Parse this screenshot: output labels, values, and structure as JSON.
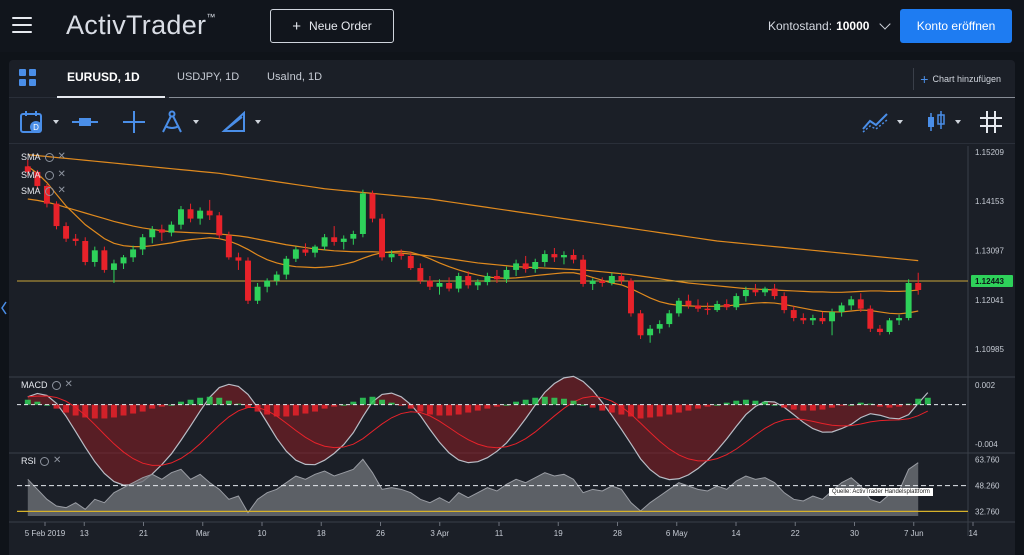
{
  "header": {
    "logo": "ActivTrader",
    "logo_tm": "™",
    "new_order_label": "Neue Order",
    "balance_label": "Kontostand:",
    "balance_value": "10000",
    "open_account_label": "Konto eröffnen"
  },
  "tabs": [
    {
      "label": "EURUSD, 1D",
      "active": true
    },
    {
      "label": "USDJPY, 1D",
      "active": false
    },
    {
      "label": "UsaInd, 1D",
      "active": false
    }
  ],
  "add_chart_label": "Chart hinzufügen",
  "indicators": {
    "sma": [
      "SMA",
      "SMA",
      "SMA"
    ],
    "macd": "MACD",
    "rsi": "RSI"
  },
  "watermark": "Quelle: ActivTrader Handelsplattform",
  "colors": {
    "up": "#2ed15a",
    "down": "#e8222a",
    "sma": "#e08a1e",
    "accent": "#1e7cf2",
    "price_line": "#c9a43a"
  },
  "chart_data": {
    "type": "candlestick",
    "symbol": "EURUSD",
    "timeframe": "1D",
    "price_axis_ticks": [
      "1.15209",
      "1.14153",
      "1.13097",
      "1.12041",
      "1.10985"
    ],
    "price_ylim": [
      1.1045,
      1.1525
    ],
    "current_price": "1.12443",
    "current_price_value": 1.12443,
    "x_tick_labels": [
      "5 Feb 2019",
      "13",
      "21",
      "Mar",
      "10",
      "18",
      "26",
      "3 Apr",
      "11",
      "19",
      "28",
      "6 May",
      "14",
      "22",
      "30",
      "7 Jun",
      "14"
    ],
    "candles": [
      [
        1.149,
        1.1505,
        1.147,
        1.1478
      ],
      [
        1.1478,
        1.1482,
        1.144,
        1.1448
      ],
      [
        1.1448,
        1.1452,
        1.1402,
        1.141
      ],
      [
        1.141,
        1.1415,
        1.1355,
        1.1362
      ],
      [
        1.1362,
        1.137,
        1.1328,
        1.1335
      ],
      [
        1.1335,
        1.1345,
        1.132,
        1.133
      ],
      [
        1.133,
        1.1338,
        1.1278,
        1.1285
      ],
      [
        1.1285,
        1.1318,
        1.1275,
        1.131
      ],
      [
        1.131,
        1.1318,
        1.1262,
        1.1268
      ],
      [
        1.1268,
        1.129,
        1.124,
        1.1282
      ],
      [
        1.1282,
        1.13,
        1.127,
        1.1295
      ],
      [
        1.1295,
        1.132,
        1.1285,
        1.1312
      ],
      [
        1.1312,
        1.1345,
        1.13,
        1.1338
      ],
      [
        1.1338,
        1.1362,
        1.1325,
        1.1355
      ],
      [
        1.1355,
        1.1365,
        1.133,
        1.1348
      ],
      [
        1.1348,
        1.1372,
        1.134,
        1.1365
      ],
      [
        1.1365,
        1.1405,
        1.1355,
        1.1398
      ],
      [
        1.1398,
        1.141,
        1.137,
        1.1378
      ],
      [
        1.1378,
        1.1402,
        1.1365,
        1.1395
      ],
      [
        1.1395,
        1.1418,
        1.1375,
        1.1385
      ],
      [
        1.1385,
        1.1392,
        1.1335,
        1.1342
      ],
      [
        1.1342,
        1.135,
        1.129,
        1.1295
      ],
      [
        1.1295,
        1.1305,
        1.1268,
        1.1288
      ],
      [
        1.1288,
        1.1295,
        1.1195,
        1.1202
      ],
      [
        1.1202,
        1.124,
        1.1195,
        1.1232
      ],
      [
        1.1232,
        1.125,
        1.122,
        1.1245
      ],
      [
        1.1245,
        1.1265,
        1.1235,
        1.1258
      ],
      [
        1.1258,
        1.1298,
        1.1248,
        1.1292
      ],
      [
        1.1292,
        1.1318,
        1.1285,
        1.1312
      ],
      [
        1.1312,
        1.1325,
        1.1298,
        1.1305
      ],
      [
        1.1305,
        1.1322,
        1.1295,
        1.1318
      ],
      [
        1.1318,
        1.1345,
        1.131,
        1.1338
      ],
      [
        1.1338,
        1.1362,
        1.132,
        1.1328
      ],
      [
        1.1328,
        1.1342,
        1.1312,
        1.1335
      ],
      [
        1.1335,
        1.1352,
        1.1322,
        1.1345
      ],
      [
        1.1345,
        1.144,
        1.1338,
        1.1432
      ],
      [
        1.1432,
        1.1438,
        1.137,
        1.1378
      ],
      [
        1.1378,
        1.1388,
        1.1288,
        1.1295
      ],
      [
        1.1295,
        1.131,
        1.1285,
        1.1302
      ],
      [
        1.1302,
        1.1312,
        1.129,
        1.1298
      ],
      [
        1.1298,
        1.1305,
        1.1268,
        1.1272
      ],
      [
        1.1272,
        1.1282,
        1.1238,
        1.1245
      ],
      [
        1.1245,
        1.1255,
        1.1225,
        1.1232
      ],
      [
        1.1232,
        1.1248,
        1.1215,
        1.124
      ],
      [
        1.124,
        1.1252,
        1.1222,
        1.1228
      ],
      [
        1.1228,
        1.1262,
        1.122,
        1.1255
      ],
      [
        1.1255,
        1.1265,
        1.1228,
        1.1235
      ],
      [
        1.1235,
        1.1248,
        1.1225,
        1.1242
      ],
      [
        1.1242,
        1.1262,
        1.1235,
        1.1255
      ],
      [
        1.1255,
        1.1268,
        1.124,
        1.1248
      ],
      [
        1.1248,
        1.1275,
        1.124,
        1.1268
      ],
      [
        1.1268,
        1.129,
        1.1255,
        1.1282
      ],
      [
        1.1282,
        1.1298,
        1.1262,
        1.127
      ],
      [
        1.127,
        1.1292,
        1.1262,
        1.1285
      ],
      [
        1.1285,
        1.131,
        1.1275,
        1.1302
      ],
      [
        1.1302,
        1.1315,
        1.1285,
        1.1295
      ],
      [
        1.1295,
        1.1308,
        1.128,
        1.13
      ],
      [
        1.13,
        1.1312,
        1.1282,
        1.129
      ],
      [
        1.129,
        1.13,
        1.1232,
        1.1238
      ],
      [
        1.1238,
        1.125,
        1.1225,
        1.1245
      ],
      [
        1.1245,
        1.1252,
        1.1232,
        1.124
      ],
      [
        1.124,
        1.1262,
        1.1235,
        1.1255
      ],
      [
        1.1255,
        1.1262,
        1.1238,
        1.1245
      ],
      [
        1.1245,
        1.125,
        1.1168,
        1.1175
      ],
      [
        1.1175,
        1.1182,
        1.112,
        1.1128
      ],
      [
        1.1128,
        1.115,
        1.1112,
        1.1142
      ],
      [
        1.1142,
        1.116,
        1.1132,
        1.1152
      ],
      [
        1.1152,
        1.1182,
        1.1145,
        1.1175
      ],
      [
        1.1175,
        1.1208,
        1.1168,
        1.1202
      ],
      [
        1.1202,
        1.1215,
        1.1185,
        1.1192
      ],
      [
        1.1192,
        1.1205,
        1.1178,
        1.1185
      ],
      [
        1.1185,
        1.1198,
        1.1172,
        1.1182
      ],
      [
        1.1182,
        1.1202,
        1.1178,
        1.1195
      ],
      [
        1.1195,
        1.1205,
        1.1182,
        1.1188
      ],
      [
        1.1188,
        1.1218,
        1.1182,
        1.1212
      ],
      [
        1.1212,
        1.1232,
        1.12,
        1.1225
      ],
      [
        1.1225,
        1.1238,
        1.1212,
        1.122
      ],
      [
        1.122,
        1.1232,
        1.1212,
        1.1228
      ],
      [
        1.1228,
        1.1238,
        1.1205,
        1.1212
      ],
      [
        1.1212,
        1.122,
        1.1175,
        1.1182
      ],
      [
        1.1182,
        1.119,
        1.1158,
        1.1165
      ],
      [
        1.1165,
        1.1175,
        1.1152,
        1.116
      ],
      [
        1.116,
        1.1172,
        1.115,
        1.1165
      ],
      [
        1.1165,
        1.1178,
        1.1152,
        1.1158
      ],
      [
        1.1158,
        1.1185,
        1.1128,
        1.1178
      ],
      [
        1.1178,
        1.1198,
        1.1168,
        1.1192
      ],
      [
        1.1192,
        1.1212,
        1.1182,
        1.1205
      ],
      [
        1.1205,
        1.1218,
        1.1178,
        1.1185
      ],
      [
        1.1185,
        1.1192,
        1.1135,
        1.1142
      ],
      [
        1.1142,
        1.115,
        1.1128,
        1.1135
      ],
      [
        1.1135,
        1.1165,
        1.113,
        1.116
      ],
      [
        1.116,
        1.1172,
        1.115,
        1.1165
      ],
      [
        1.1165,
        1.1248,
        1.116,
        1.124
      ],
      [
        1.124,
        1.1262,
        1.1215,
        1.1225
      ]
    ],
    "sma_series": [
      {
        "name": "SMA",
        "values": [
          1.149,
          1.1475,
          1.1455,
          1.143,
          1.1405,
          1.1385,
          1.1365,
          1.135,
          1.1335,
          1.1325,
          1.132,
          1.1318,
          1.1318,
          1.132,
          1.1323,
          1.1326,
          1.133,
          1.1333,
          1.1335,
          1.1337,
          1.1335,
          1.133,
          1.1322,
          1.1312,
          1.13,
          1.129,
          1.1283,
          1.1278,
          1.1275,
          1.1274,
          1.1273,
          1.1274,
          1.1276,
          1.128,
          1.1285,
          1.1293,
          1.13,
          1.1305,
          1.1307,
          1.1308,
          1.1306,
          1.13,
          1.1292,
          1.1283,
          1.1275,
          1.1268,
          1.1262,
          1.1257,
          1.1253,
          1.1251,
          1.125,
          1.1251,
          1.1253,
          1.1256,
          1.1258,
          1.126,
          1.1262,
          1.1262,
          1.1258,
          1.1252,
          1.1246,
          1.124,
          1.1236,
          1.1228,
          1.1218,
          1.1208,
          1.12,
          1.1195,
          1.1192,
          1.1191,
          1.119,
          1.119,
          1.119,
          1.1191,
          1.1193,
          1.1195,
          1.1197,
          1.1198,
          1.1197,
          1.1194,
          1.119,
          1.1186,
          1.1182,
          1.1179,
          1.1178,
          1.1178,
          1.118,
          1.1182,
          1.1181,
          1.1178,
          1.1175,
          1.1174,
          1.1176,
          1.118
        ]
      },
      {
        "name": "SMA",
        "values": [
          1.142,
          1.1417,
          1.1413,
          1.1408,
          1.1402,
          1.1396,
          1.139,
          1.1384,
          1.1378,
          1.1372,
          1.1367,
          1.1362,
          1.1358,
          1.1355,
          1.1352,
          1.135,
          1.1349,
          1.1348,
          1.1347,
          1.1346,
          1.1345,
          1.1343,
          1.1341,
          1.1338,
          1.1334,
          1.133,
          1.1326,
          1.1322,
          1.1319,
          1.1316,
          1.1313,
          1.1311,
          1.1309,
          1.1308,
          1.1307,
          1.1307,
          1.1307,
          1.1306,
          1.1305,
          1.1304,
          1.1302,
          1.13,
          1.1298,
          1.1295,
          1.1292,
          1.1289,
          1.1286,
          1.1283,
          1.1281,
          1.1279,
          1.1277,
          1.1275,
          1.1274,
          1.1273,
          1.1272,
          1.1271,
          1.127,
          1.1269,
          1.1268,
          1.1266,
          1.1264,
          1.1262,
          1.126,
          1.1258,
          1.1255,
          1.1252,
          1.1249,
          1.1246,
          1.1243,
          1.124,
          1.1238,
          1.1236,
          1.1234,
          1.1232,
          1.123,
          1.1228,
          1.1227,
          1.1226,
          1.1225,
          1.1224,
          1.1223,
          1.1222,
          1.1221,
          1.1221,
          1.122,
          1.122,
          1.1221,
          1.1222,
          1.1223,
          1.1223,
          1.1222,
          1.1222,
          1.1223,
          1.1225
        ]
      },
      {
        "name": "SMA",
        "values": [
          1.1515,
          1.1513,
          1.1511,
          1.1509,
          1.1507,
          1.1505,
          1.1503,
          1.1501,
          1.1499,
          1.1497,
          1.1495,
          1.1493,
          1.1491,
          1.1489,
          1.1487,
          1.1485,
          1.1483,
          1.1481,
          1.1479,
          1.1477,
          1.1475,
          1.1472,
          1.1469,
          1.1466,
          1.1463,
          1.146,
          1.1457,
          1.1454,
          1.1451,
          1.1448,
          1.1445,
          1.1442,
          1.144,
          1.1438,
          1.1436,
          1.1434,
          1.1432,
          1.143,
          1.1428,
          1.1426,
          1.1424,
          1.1422,
          1.142,
          1.1417,
          1.1414,
          1.1411,
          1.1408,
          1.1405,
          1.1402,
          1.1399,
          1.1396,
          1.1393,
          1.139,
          1.1387,
          1.1384,
          1.1381,
          1.1378,
          1.1375,
          1.1372,
          1.1369,
          1.1366,
          1.1363,
          1.136,
          1.1357,
          1.1354,
          1.1351,
          1.1348,
          1.1345,
          1.1342,
          1.1339,
          1.1336,
          1.1333,
          1.133,
          1.1328,
          1.1326,
          1.1324,
          1.1322,
          1.132,
          1.1318,
          1.1316,
          1.1314,
          1.1312,
          1.131,
          1.1308,
          1.1306,
          1.1304,
          1.1302,
          1.13,
          1.1298,
          1.1296,
          1.1294,
          1.1292,
          1.129,
          1.1288
        ]
      }
    ],
    "macd_axis_ticks": [
      "0.002",
      "-0.004"
    ],
    "macd_ylim": [
      -0.0048,
      0.0025
    ],
    "macd_histogram": [
      0.0005,
      0.0003,
      0.0,
      -0.0004,
      -0.0008,
      -0.0011,
      -0.0013,
      -0.0014,
      -0.0014,
      -0.0013,
      -0.0011,
      -0.0009,
      -0.0007,
      -0.0004,
      -0.0002,
      0.0,
      0.0003,
      0.0005,
      0.0007,
      0.0008,
      0.0007,
      0.0004,
      0.0001,
      -0.0003,
      -0.0007,
      -0.001,
      -0.0012,
      -0.0012,
      -0.0011,
      -0.0009,
      -0.0007,
      -0.0004,
      -0.0002,
      0.0,
      0.0003,
      0.0007,
      0.0008,
      0.0005,
      0.0002,
      -0.0001,
      -0.0004,
      -0.0007,
      -0.001,
      -0.0011,
      -0.0011,
      -0.001,
      -0.0008,
      -0.0006,
      -0.0004,
      -0.0002,
      0.0,
      0.0003,
      0.0005,
      0.0007,
      0.0008,
      0.0007,
      0.0006,
      0.0004,
      0.0,
      -0.0003,
      -0.0006,
      -0.0008,
      -0.001,
      -0.0012,
      -0.0014,
      -0.0013,
      -0.0012,
      -0.001,
      -0.0008,
      -0.0006,
      -0.0004,
      -0.0002,
      0.0,
      0.0002,
      0.0004,
      0.0005,
      0.0004,
      0.0003,
      0.0,
      -0.0003,
      -0.0005,
      -0.0006,
      -0.0006,
      -0.0005,
      -0.0003,
      -0.0001,
      0.0,
      0.0002,
      0.0001,
      -0.0002,
      -0.0003,
      -0.0002,
      0.0001,
      0.0006,
      0.0007
    ],
    "rsi_axis_ticks": [
      "63.760",
      "48.260",
      "32.760"
    ],
    "rsi_ylim": [
      30,
      66
    ],
    "rsi_values": [
      52,
      46,
      40,
      36,
      35,
      38,
      34,
      40,
      38,
      44,
      47,
      50,
      53,
      55,
      52,
      56,
      58,
      52,
      55,
      50,
      46,
      40,
      42,
      32,
      40,
      44,
      46,
      50,
      54,
      52,
      55,
      57,
      54,
      56,
      58,
      64,
      56,
      46,
      47,
      46,
      44,
      40,
      38,
      41,
      38,
      44,
      41,
      44,
      47,
      45,
      49,
      52,
      50,
      53,
      56,
      54,
      55,
      52,
      44,
      46,
      45,
      48,
      46,
      38,
      33,
      38,
      42,
      46,
      50,
      48,
      46,
      45,
      48,
      46,
      51,
      54,
      52,
      53,
      50,
      44,
      40,
      39,
      42,
      40,
      45,
      50,
      53,
      48,
      40,
      38,
      43,
      45,
      58,
      62
    ]
  }
}
